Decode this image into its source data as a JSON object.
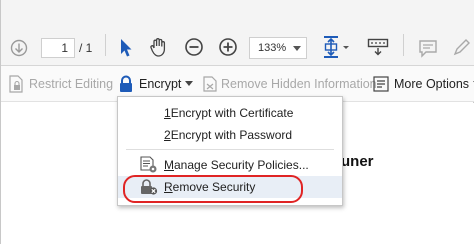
{
  "toolbar": {
    "page_current": "1",
    "page_total": "/ 1",
    "zoom": "133%",
    "icons": [
      "down-arrow-circle-icon",
      "select-arrow-icon",
      "hand-icon",
      "zoom-out-icon",
      "zoom-in-icon",
      "fit-page-icon",
      "keyboard-icon",
      "comment-icon",
      "pen-icon"
    ]
  },
  "protect_bar": {
    "restrict_editing": "Restrict Editing",
    "encrypt": "Encrypt",
    "remove_hidden": "Remove Hidden Information",
    "more_options": "More Options"
  },
  "menu": {
    "encrypt_certificate": {
      "accel": "1",
      "text": " Encrypt with Certificate"
    },
    "encrypt_password": {
      "accel": "2",
      "text": " Encrypt with Password"
    },
    "manage_policies": {
      "accel": "M",
      "text": "anage Security Policies..."
    },
    "remove_security": {
      "accel": "R",
      "text": "emove Security"
    }
  },
  "document": {
    "visible_text": "uner"
  },
  "colors": {
    "accent_blue": "#1e5bb8",
    "highlight_red": "#e02424",
    "menu_hover": "#e8eef6"
  }
}
